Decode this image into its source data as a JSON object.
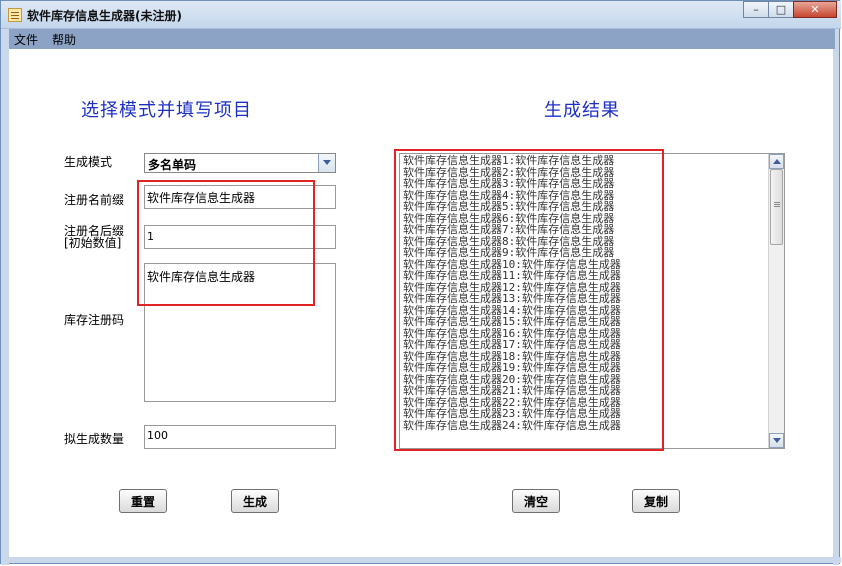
{
  "window": {
    "title": "软件库存信息生成器(未注册)",
    "controls": {
      "minimize": "–",
      "maximize": "□",
      "close": "✕"
    }
  },
  "menu": {
    "items": [
      "文件",
      "帮助"
    ]
  },
  "left": {
    "title": "选择模式并填写项目",
    "mode_label": "生成模式",
    "mode_value": "多名单码",
    "prefix_label": "注册名前缀",
    "prefix_value": "软件库存信息生成器",
    "suffix_label_line1": "注册名后缀",
    "suffix_label_line2": "[初始数值]",
    "suffix_value": "1",
    "code_label": "库存注册码",
    "code_value": "软件库存信息生成器",
    "count_label": "拟生成数量",
    "count_value": "100",
    "reset_button": "重置",
    "generate_button": "生成"
  },
  "right": {
    "title": "生成结果",
    "clear_button": "清空",
    "copy_button": "复制",
    "output_lines": [
      "软件库存信息生成器1:软件库存信息生成器",
      "软件库存信息生成器2:软件库存信息生成器",
      "软件库存信息生成器3:软件库存信息生成器",
      "软件库存信息生成器4:软件库存信息生成器",
      "软件库存信息生成器5:软件库存信息生成器",
      "软件库存信息生成器6:软件库存信息生成器",
      "软件库存信息生成器7:软件库存信息生成器",
      "软件库存信息生成器8:软件库存信息生成器",
      "软件库存信息生成器9:软件库存信息生成器",
      "软件库存信息生成器10:软件库存信息生成器",
      "软件库存信息生成器11:软件库存信息生成器",
      "软件库存信息生成器12:软件库存信息生成器",
      "软件库存信息生成器13:软件库存信息生成器",
      "软件库存信息生成器14:软件库存信息生成器",
      "软件库存信息生成器15:软件库存信息生成器",
      "软件库存信息生成器16:软件库存信息生成器",
      "软件库存信息生成器17:软件库存信息生成器",
      "软件库存信息生成器18:软件库存信息生成器",
      "软件库存信息生成器19:软件库存信息生成器",
      "软件库存信息生成器20:软件库存信息生成器",
      "软件库存信息生成器21:软件库存信息生成器",
      "软件库存信息生成器22:软件库存信息生成器",
      "软件库存信息生成器23:软件库存信息生成器",
      "软件库存信息生成器24:软件库存信息生成器"
    ]
  },
  "colors": {
    "highlight_box": "#e02424",
    "section_title": "#1d30c4",
    "menubar": "#8da3c6"
  }
}
